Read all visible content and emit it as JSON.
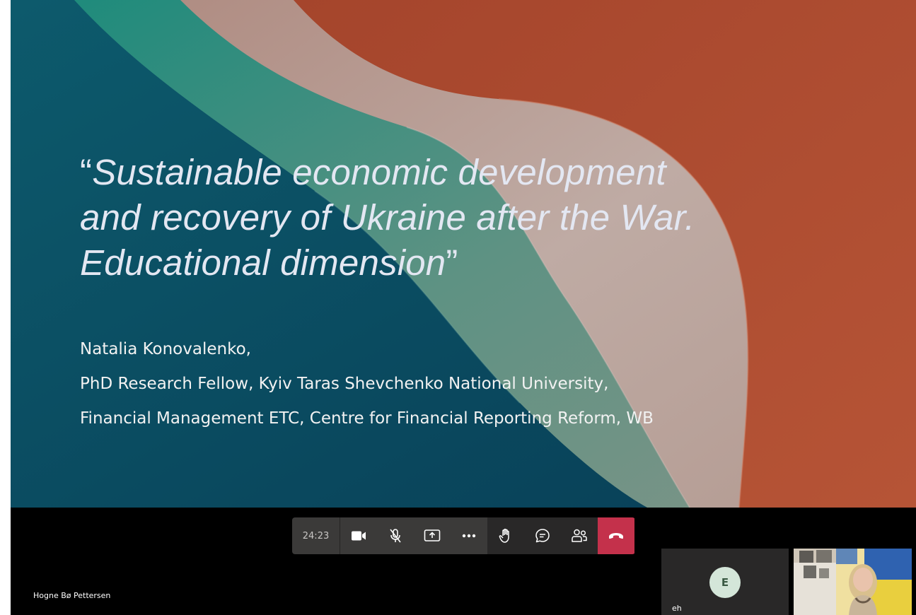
{
  "slide": {
    "title_open_quote": "“",
    "title_line1": "Sustainable economic development",
    "title_line2": "and recovery of Ukraine after the War.",
    "title_line3": "Educational dimension",
    "title_close_quote": "”",
    "author_name": "Natalia Konovalenko,",
    "author_line2": "PhD Research Fellow, Kyiv Taras Shevchenko National University,",
    "author_line3": "Financial Management ETC, Centre for Financial Reporting Reform, WB"
  },
  "controls": {
    "timer": "24:23",
    "buttons": [
      "camera-icon",
      "mic-off-icon",
      "share-screen-icon",
      "more-options-icon",
      "raise-hand-icon",
      "chat-icon",
      "participants-icon",
      "hang-up-icon"
    ],
    "end_color": "#c4314b"
  },
  "presenter": {
    "name": "Hogne Bø Pettersen"
  },
  "participants": [
    {
      "initial": "E",
      "name": "eh"
    },
    {
      "type": "video"
    }
  ]
}
